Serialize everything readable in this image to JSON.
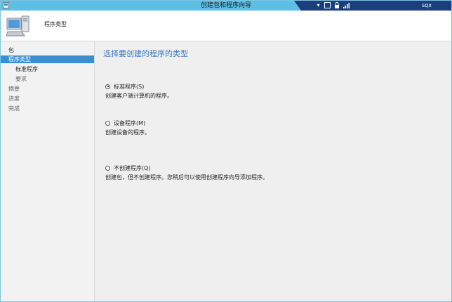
{
  "window": {
    "title": "创建包和程序向导"
  },
  "rdp": {
    "user": "sqx",
    "pin_glyph": "▾",
    "min_glyph": "▬",
    "lock_glyph": "🔒",
    "signal_glyph": "▮"
  },
  "header": {
    "title": "程序类型"
  },
  "nav": {
    "items": [
      {
        "label": "包"
      },
      {
        "label": "程序类型"
      },
      {
        "label": "标准程序"
      },
      {
        "label": "要求"
      },
      {
        "label": "摘要"
      },
      {
        "label": "进度"
      },
      {
        "label": "完成"
      }
    ]
  },
  "main": {
    "title": "选择要创建的程序的类型",
    "options": [
      {
        "label": "标准程序(S)",
        "desc": "创建客户端计算机的程序。",
        "checked": true
      },
      {
        "label": "设备程序(M)",
        "desc": "创建设备的程序。",
        "checked": false
      },
      {
        "label": "不创建程序(Q)",
        "desc": "创建包，但不创建程序。您稍后可以使用创建程序向导添加程序。",
        "checked": false
      }
    ]
  },
  "colors": {
    "titlebar": "#5bc0e4",
    "rdp_bar": "#1b3f7e",
    "nav_selected": "#3b8fd1",
    "heading": "#3a78c2"
  }
}
